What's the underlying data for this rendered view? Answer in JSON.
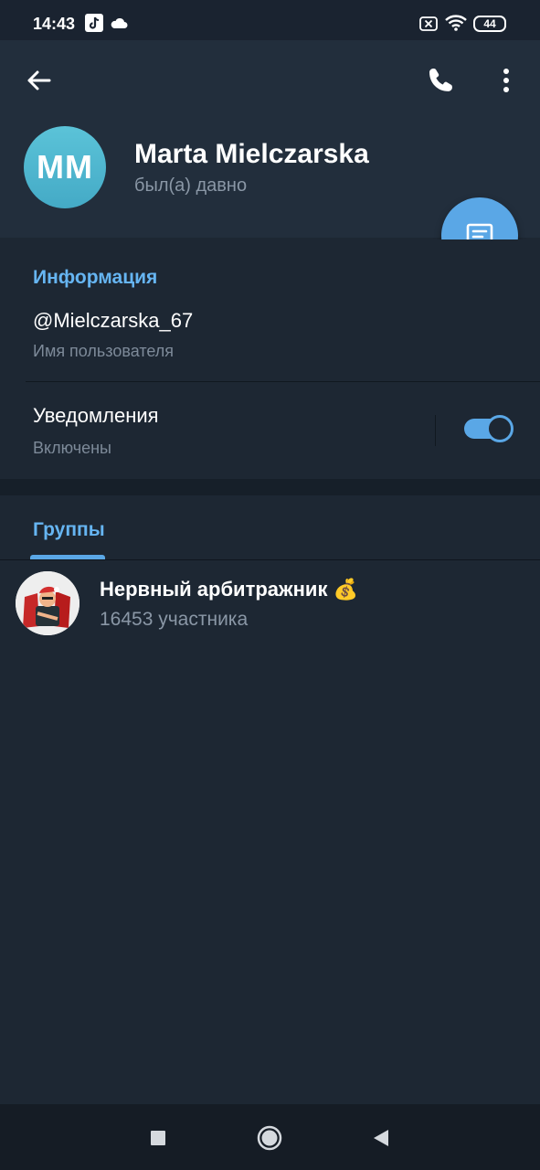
{
  "status_bar": {
    "time": "14:43",
    "battery": "44",
    "icons": [
      "tiktok-icon",
      "cloud-icon",
      "no-sim-icon",
      "wifi-icon",
      "battery-icon"
    ]
  },
  "header": {
    "avatar_initials": "MM",
    "name": "Marta Mielczarska",
    "last_seen": "был(а) давно",
    "avatar_color": "#4fb6cf"
  },
  "info": {
    "title": "Информация",
    "username": "@Mielczarska_67",
    "username_label": "Имя пользователя",
    "notifications_label": "Уведомления",
    "notifications_state": "Включены",
    "notifications_on": true
  },
  "groups": {
    "tab_label": "Группы",
    "items": [
      {
        "name": "Нервный арбитражник 💰",
        "members": "16453 участника"
      }
    ]
  },
  "colors": {
    "accent": "#5aa7e6",
    "section_title": "#66b5f2",
    "background": "#1d2733",
    "header_bg": "#222e3c"
  }
}
